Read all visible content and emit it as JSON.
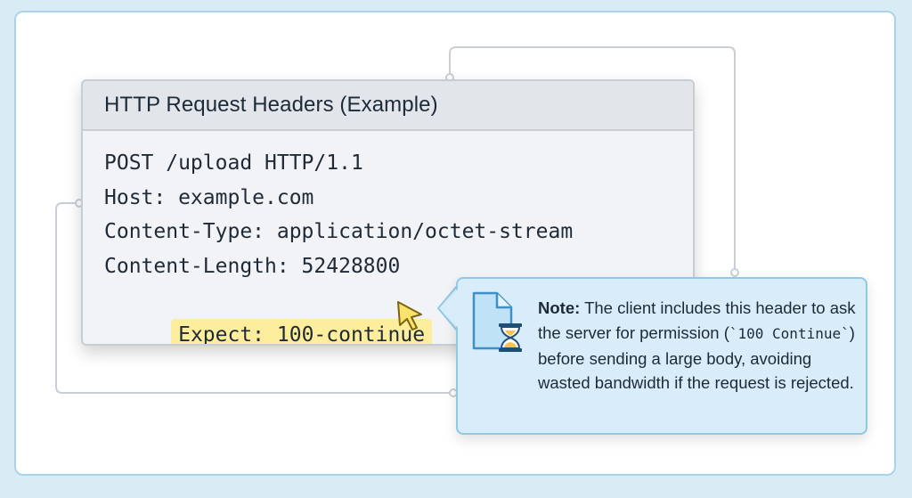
{
  "card": {
    "title": "HTTP Request Headers (Example)",
    "lines": [
      "POST /upload HTTP/1.1",
      "Host: example.com",
      "Content-Type: application/octet-stream",
      "Content-Length: 52428800"
    ],
    "highlighted_line": "Expect: 100-continue"
  },
  "note": {
    "label": "Note:",
    "text_1": " The client includes this header to ask the server for permission (",
    "code": "`100 Continue`",
    "text_2": ") before sending a large body, avoiding wasted bandwidth if the request is rejected.",
    "icon": "document-hourglass-icon"
  },
  "colors": {
    "frame_border": "#a9d3ea",
    "highlight": "#fcee9c",
    "note_background": "#d8edf9",
    "note_border": "#8fc9e6",
    "connector": "#c9ced6"
  }
}
